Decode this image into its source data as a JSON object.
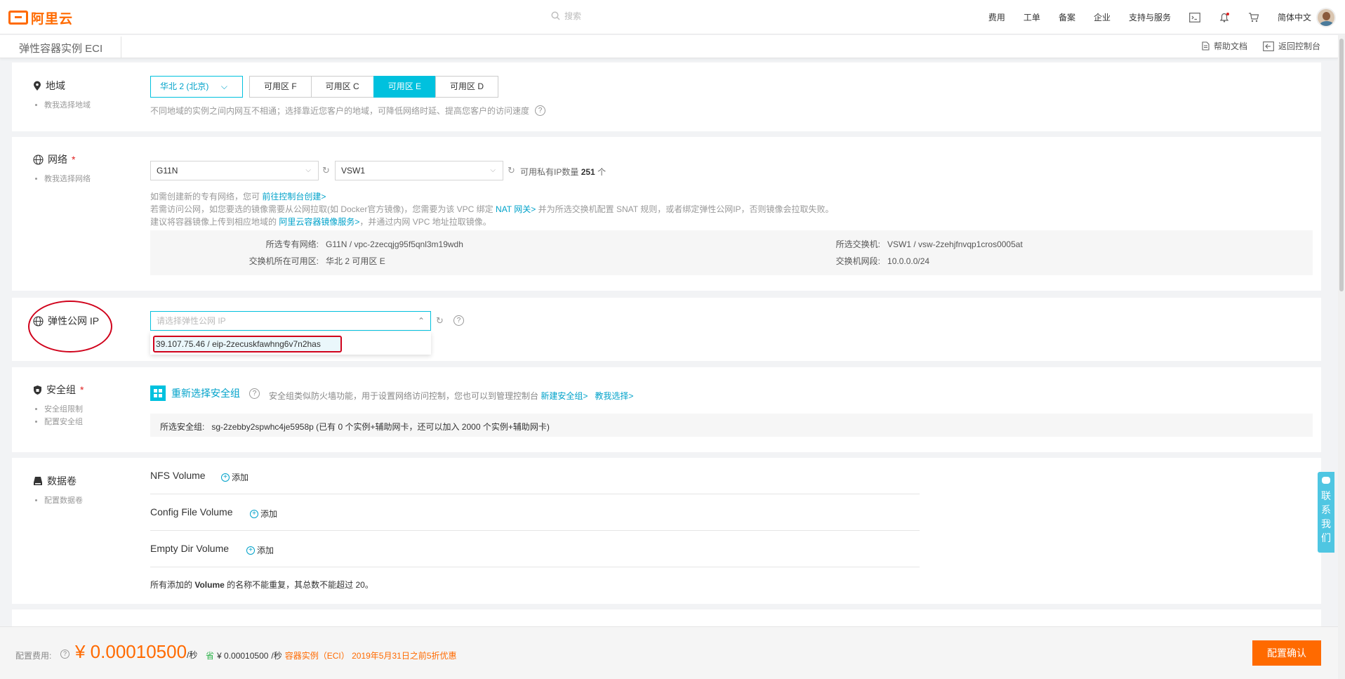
{
  "topbar": {
    "logo_text": "阿里云",
    "search_placeholder": "搜索",
    "nav": [
      "费用",
      "工单",
      "备案",
      "企业",
      "支持与服务"
    ],
    "language": "简体中文"
  },
  "subbar": {
    "title": "弹性容器实例 ECI",
    "help_docs": "帮助文档",
    "back_console": "返回控制台"
  },
  "region": {
    "label": "地域",
    "sub": "教我选择地域",
    "selected_region": "华北 2 (北京)",
    "zones": [
      "可用区 F",
      "可用区 C",
      "可用区 E",
      "可用区 D"
    ],
    "active_zone": "可用区 E",
    "hint": "不同地域的实例之间内网互不相通；选择靠近您客户的地域，可降低网络时延、提高您客户的访问速度"
  },
  "network": {
    "label": "网络",
    "required": "*",
    "sub": "教我选择网络",
    "vpc": "G11N",
    "vswitch": "VSW1",
    "available_ip_prefix": "可用私有IP数量",
    "available_ip_count": "251",
    "available_ip_suffix": "个",
    "note1_a": "如需创建新的专有网络，您可",
    "note1_link": "前往控制台创建>",
    "note2_a": "若需访问公网，如您要选的镜像需要从公网拉取(如 Docker官方镜像)，您需要为该 VPC 绑定",
    "note2_link": "NAT 网关>",
    "note2_b": "并为所选交换机配置 SNAT 规则，或者绑定弹性公网IP，否则镜像会拉取失败。",
    "note3_a": "建议将容器镜像上传到相应地域的",
    "note3_link": "阿里云容器镜像服务>",
    "note3_b": "，并通过内网 VPC 地址拉取镜像。",
    "info": {
      "vpc_k": "所选专有网络:",
      "vpc_v": "G11N / vpc-2zecqjg95f5qnl3m19wdh",
      "zone_k": "交换机所在可用区:",
      "zone_v": "华北 2 可用区 E",
      "vsw_k": "所选交换机:",
      "vsw_v": "VSW1 / vsw-2zehjfnvqp1cros0005at",
      "cidr_k": "交换机网段:",
      "cidr_v": "10.0.0.0/24"
    }
  },
  "eip": {
    "label": "弹性公网 IP",
    "placeholder": "请选择弹性公网 IP",
    "option": "39.107.75.46 / eip-2zecuskfawhng6v7n2has"
  },
  "security": {
    "label": "安全组",
    "required": "*",
    "sub1": "安全组限制",
    "sub2": "配置安全组",
    "reselect": "重新选择安全组",
    "desc": "安全组类似防火墙功能，用于设置网络访问控制，您也可以到管理控制台",
    "link_new": "新建安全组>",
    "link_teach": "教我选择>",
    "selected_k": "所选安全组:",
    "selected_v": "sg-2zebby2spwhc4je5958p  (已有 0 个实例+辅助网卡，还可以加入 2000 个实例+辅助网卡)"
  },
  "volumes": {
    "label": "数据卷",
    "sub": "配置数据卷",
    "rows": [
      "NFS Volume",
      "Config File Volume",
      "Empty Dir Volume"
    ],
    "add": "添加",
    "note_a": "所有添加的",
    "note_b": "Volume",
    "note_c": "的名称不能重复，其总数不能超过 20。"
  },
  "footer": {
    "fee_label": "配置费用:",
    "price": "¥ 0.00010500",
    "price_unit": "/秒",
    "save_label": "省",
    "save_price": "¥ 0.00010500",
    "save_unit": "/秒",
    "promo": "容器实例（ECI） 2019年5月31日之前5折优惠",
    "confirm": "配置确认"
  },
  "contact": "联系我们",
  "colors": {
    "accent": "#00c1de",
    "brand": "#ff6a00",
    "highlight": "#d0021b"
  }
}
